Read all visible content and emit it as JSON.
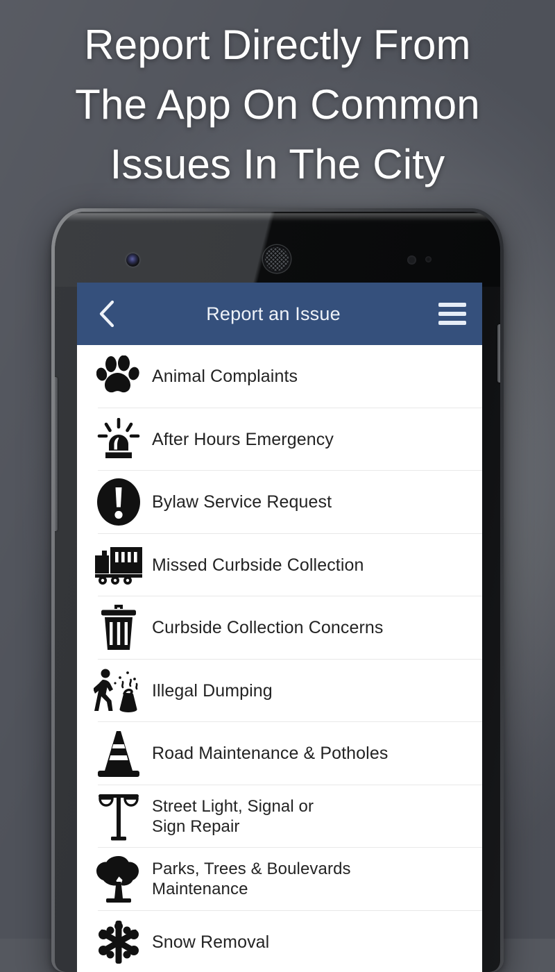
{
  "headline": {
    "lines": [
      "Report Directly From",
      "The App On Common",
      "Issues In The City"
    ]
  },
  "colors": {
    "appbar_blue": "#35507c",
    "appbar_text": "#eef2f8",
    "list_text": "#232323",
    "separator": "#e8e8e8",
    "screen_background": "#ffffff",
    "backdrop_dark": "#54575f",
    "backdrop_light": "#7b7d81"
  },
  "phone": {
    "hardware": {
      "front_camera": "front-camera",
      "earpiece_speaker": "earpiece-speaker",
      "proximity_sensor": "proximity-sensor",
      "light_sensor": "light-sensor",
      "volume_rocker": "volume-rocker-button",
      "power_button": "power-button"
    }
  },
  "app": {
    "appbar": {
      "back_icon": "chevron-left-icon",
      "title": "Report an Issue",
      "menu_icon": "hamburger-menu-icon"
    },
    "list": {
      "items": [
        {
          "label": "Animal Complaints",
          "icon": "paw-print-icon",
          "lines": 1
        },
        {
          "label": "After Hours Emergency",
          "icon": "siren-light-icon",
          "lines": 1
        },
        {
          "label": "Bylaw Service Request",
          "icon": "exclamation-circle-icon",
          "lines": 1
        },
        {
          "label": "Missed Curbside Collection",
          "icon": "garbage-truck-icon",
          "lines": 1
        },
        {
          "label": "Curbside Collection Concerns",
          "icon": "trash-can-icon",
          "lines": 1
        },
        {
          "label": "Illegal Dumping",
          "icon": "illegal-dumping-icon",
          "lines": 1
        },
        {
          "label": "Road Maintenance & Potholes",
          "icon": "traffic-cone-icon",
          "lines": 1
        },
        {
          "label": "Street Light, Signal or\nSign Repair",
          "icon": "street-lamp-icon",
          "lines": 2
        },
        {
          "label": "Parks, Trees & Boulevards\nMaintenance",
          "icon": "tree-icon",
          "lines": 2
        },
        {
          "label": "Snow Removal",
          "icon": "snowflake-icon",
          "lines": 1
        }
      ]
    }
  }
}
